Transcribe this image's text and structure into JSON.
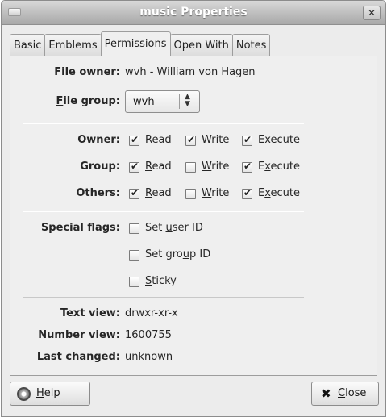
{
  "window": {
    "title": "music Properties",
    "close_glyph": "✕"
  },
  "tabs": [
    {
      "label": "Basic"
    },
    {
      "label": "Emblems"
    },
    {
      "label": "Permissions"
    },
    {
      "label": "Open With"
    },
    {
      "label": "Notes"
    }
  ],
  "permissions": {
    "file_owner_label": "File owner:",
    "file_owner_value": "wvh - William von Hagen",
    "file_group_label_mnemonic": "F",
    "file_group_label_rest": "ile group:",
    "file_group_value": "wvh",
    "rows": [
      {
        "label": "Owner:",
        "read": true,
        "write": true,
        "execute": true
      },
      {
        "label": "Group:",
        "read": true,
        "write": false,
        "execute": true
      },
      {
        "label": "Others:",
        "read": true,
        "write": false,
        "execute": true
      }
    ],
    "read_label_mnemonic": "R",
    "read_label_rest": "ead",
    "write_label_mnemonic": "W",
    "write_label_rest": "rite",
    "execute_label_pre": "E",
    "execute_label_mnemonic": "x",
    "execute_label_rest": "ecute",
    "special_flags_label": "Special flags:",
    "set_user_id_pre": "Set ",
    "set_user_id_mnemonic": "u",
    "set_user_id_rest": "ser ID",
    "set_user_id_checked": false,
    "set_group_id_pre": "Set gro",
    "set_group_id_mnemonic": "u",
    "set_group_id_rest": "p ID",
    "set_group_id_checked": false,
    "sticky_mnemonic": "S",
    "sticky_rest": "ticky",
    "sticky_checked": false,
    "text_view_label": "Text view:",
    "text_view_value": "drwxr-xr-x",
    "number_view_label": "Number view:",
    "number_view_value": "1600755",
    "last_changed_label": "Last changed:",
    "last_changed_value": "unknown"
  },
  "buttons": {
    "help_mnemonic": "H",
    "help_rest": "elp",
    "close_glyph": "✖",
    "close_mnemonic": "C",
    "close_rest": "lose"
  }
}
